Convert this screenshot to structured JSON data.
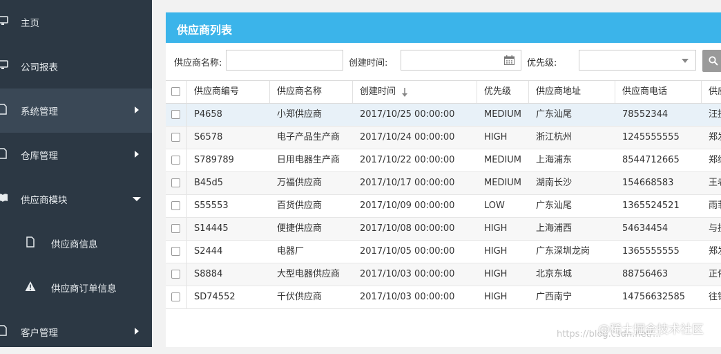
{
  "sidebar": {
    "items": [
      {
        "label": "主页",
        "icon": "monitor-icon"
      },
      {
        "label": "公司报表",
        "icon": "monitor-icon"
      },
      {
        "label": "系统管理",
        "icon": "document-icon",
        "arrow": "caret-right-icon"
      },
      {
        "label": "仓库管理",
        "icon": "document-icon",
        "arrow": "caret-right-icon"
      },
      {
        "label": "供应商模块",
        "icon": "book-icon",
        "arrow": "caret-down-icon"
      },
      {
        "label": "供应商信息",
        "icon": "document-icon"
      },
      {
        "label": "供应商订单信息",
        "icon": "warning-icon"
      },
      {
        "label": "客户管理",
        "icon": "document-icon",
        "arrow": "caret-right-icon"
      }
    ]
  },
  "panel": {
    "title": "供应商列表"
  },
  "filters": {
    "name_label": "供应商名称:",
    "name_value": "",
    "created_label": "创建时间:",
    "created_value": "",
    "priority_label": "优先级:",
    "priority_value": ""
  },
  "table": {
    "columns": [
      "供应商编号",
      "供应商名称",
      "创建时间",
      "优先级",
      "供应商地址",
      "供应商电话",
      "供应"
    ],
    "rows": [
      [
        "P4658",
        "小郑供应商",
        "2017/10/25 00:00:00",
        "MEDIUM",
        "广东汕尾",
        "78552344",
        "汪挂"
      ],
      [
        "S6578",
        "电子产品生产商",
        "2017/10/24 00:00:00",
        "HIGH",
        "浙江杭州",
        "1245555555",
        "郑发"
      ],
      [
        "S789789",
        "日用电器生产商",
        "2017/10/22 00:00:00",
        "MEDIUM",
        "上海浦东",
        "8544712665",
        "郑结"
      ],
      [
        "B45d5",
        "万福供应商",
        "2017/10/17 00:00:00",
        "MEDIUM",
        "湖南长沙",
        "154668583",
        "王老"
      ],
      [
        "S55553",
        "百货供应商",
        "2017/10/09 00:00:00",
        "LOW",
        "广东汕尾",
        "1365524521",
        "雨菲"
      ],
      [
        "S14445",
        "便捷供应商",
        "2017/10/08 00:00:00",
        "HIGH",
        "上海浦西",
        "54634454",
        "与揆"
      ],
      [
        "S2444",
        "电器厂",
        "2017/10/05 00:00:00",
        "HIGH",
        "广东深圳龙岗",
        "1365555555",
        "郑发"
      ],
      [
        "S8884",
        "大型电器供应商",
        "2017/10/03 00:00:00",
        "HIGH",
        "北京东城",
        "88756463",
        "正依"
      ],
      [
        "SD74552",
        "千伏供应商",
        "2017/10/03 00:00:00",
        "HIGH",
        "广西南宁",
        "14756632585",
        "往钱"
      ]
    ]
  },
  "watermark": {
    "text": "@稀土掘金技术社区",
    "url": "https://blog.csdn.net/..."
  },
  "colors": {
    "sidebar": "#2c3844",
    "sidebar_active": "#3a4856",
    "header": "#3bb4ea",
    "selected_row": "#e8f1f8"
  }
}
